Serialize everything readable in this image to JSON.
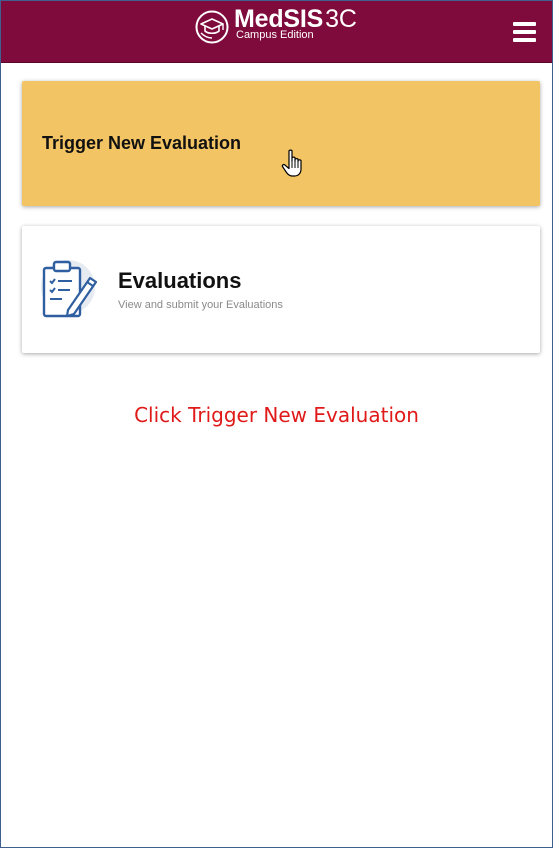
{
  "header": {
    "brand_name": "MedSIS",
    "brand_version": "3C",
    "brand_edition": "Campus Edition",
    "logo_icon": "graduation-cap-logo-icon",
    "menu_icon": "hamburger-menu-icon",
    "background_color": "#7f0a3c"
  },
  "cards": {
    "trigger": {
      "label": "Trigger New Evaluation",
      "background_color": "#f2c463",
      "cursor_icon": "hand-pointer-cursor-icon"
    },
    "evaluations": {
      "title": "Evaluations",
      "subtitle": "View and submit your Evaluations",
      "icon": "clipboard-checklist-pencil-icon"
    }
  },
  "instruction": {
    "text": "Click Trigger New Evaluation",
    "color": "#e01919"
  }
}
